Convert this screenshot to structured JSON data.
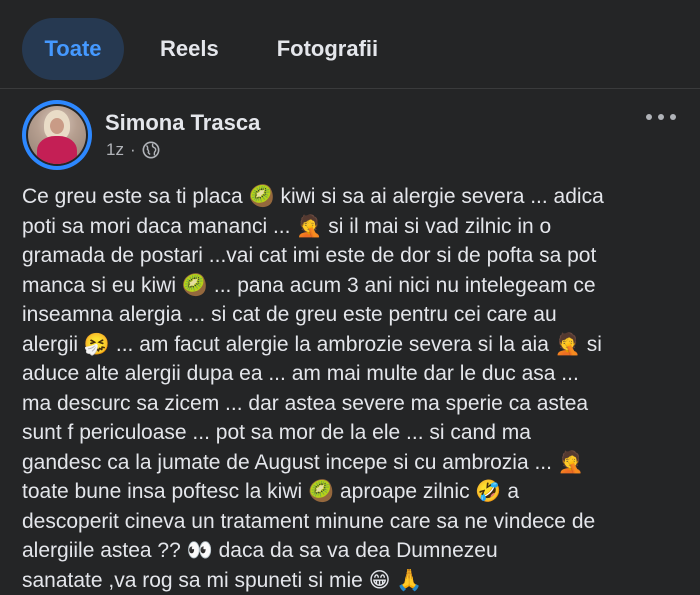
{
  "tabs": [
    {
      "label": "Toate",
      "active": true
    },
    {
      "label": "Reels",
      "active": false
    },
    {
      "label": "Fotografii",
      "active": false
    }
  ],
  "post": {
    "author": "Simona Trasca",
    "time": "1z",
    "separator": "·",
    "audience_icon": "globe-icon",
    "more_icon": "more-options-icon",
    "lines": [
      [
        "Ce greu este sa ti placa ",
        "🥝",
        " kiwi  si sa ai alergie severa ... adica"
      ],
      [
        "poti sa mori daca mananci ... ",
        "🤦",
        "  si il mai si vad zilnic in o"
      ],
      [
        "gramada de postari ...vai cat imi este de dor si de pofta sa pot"
      ],
      [
        "manca si eu kiwi ",
        "🥝",
        " ... pana acum 3 ani nici nu intelegeam  ce"
      ],
      [
        "inseamna alergia  ... si cat de greu este pentru cei care au"
      ],
      [
        "alergii ",
        "🤧",
        " ... am facut alergie la ambrozie severa si la aia ",
        "🤦",
        " si"
      ],
      [
        "aduce alte alergii dupa ea ... am mai multe dar  le duc asa  ..."
      ],
      [
        "ma descurc sa zicem ... dar astea severe ma sperie ca astea"
      ],
      [
        "sunt f periculoase ... pot sa mor de la ele ... si cand ma"
      ],
      [
        "gandesc ca la jumate de August incepe si cu ambrozia ... ",
        "🤦"
      ],
      [
        "toate bune insa poftesc la kiwi ",
        "🥝",
        " aproape zilnic ",
        "🤣",
        " a"
      ],
      [
        "descoperit cineva un tratament minune care sa ne vindece de"
      ],
      [
        "alergiile astea ?? ",
        "👀",
        " daca da sa va dea Dumnezeu"
      ],
      [
        "sanatate ,va rog sa mi spuneti si mie ",
        "😁",
        " ",
        "🙏"
      ]
    ]
  },
  "colors": {
    "background": "#242526",
    "active_tab_bg": "#263951",
    "active_tab_text": "#4599ff",
    "text": "#e4e6eb",
    "muted": "#b0b3b8",
    "avatar_ring": "#2d88ff"
  }
}
